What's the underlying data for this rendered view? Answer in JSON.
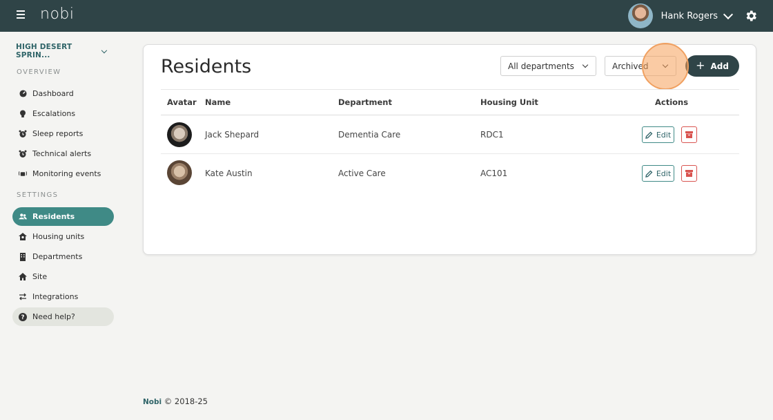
{
  "topbar": {
    "logo": "nobi",
    "user_name": "Hank Rogers"
  },
  "sidebar": {
    "site_name": "HIGH DESERT SPRIN...",
    "overview_label": "OVERVIEW",
    "settings_label": "SETTINGS",
    "overview_items": [
      {
        "label": "Dashboard",
        "icon": "dashboard-icon"
      },
      {
        "label": "Escalations",
        "icon": "lightbulb-icon"
      },
      {
        "label": "Sleep reports",
        "icon": "alarm-icon"
      },
      {
        "label": "Technical alerts",
        "icon": "alarm-icon"
      },
      {
        "label": "Monitoring events",
        "icon": "broadcast-icon"
      }
    ],
    "settings_items": [
      {
        "label": "Residents",
        "icon": "users-icon",
        "active": true
      },
      {
        "label": "Housing units",
        "icon": "house-icon"
      },
      {
        "label": "Departments",
        "icon": "building-icon"
      },
      {
        "label": "Site",
        "icon": "home-icon"
      },
      {
        "label": "Integrations",
        "icon": "swap-icon"
      }
    ],
    "help_label": "Need help?"
  },
  "main": {
    "title": "Residents",
    "department_filter": "All departments",
    "status_filter": "Archived",
    "add_label": "Add",
    "columns": [
      "Avatar",
      "Name",
      "Department",
      "Housing Unit",
      "Actions"
    ],
    "rows": [
      {
        "name": "Jack Shepard",
        "department": "Dementia Care",
        "housing_unit": "RDC1",
        "edit_label": "Edit"
      },
      {
        "name": "Kate Austin",
        "department": "Active Care",
        "housing_unit": "AC101",
        "edit_label": "Edit"
      }
    ]
  },
  "footer": {
    "brand": "Nobi",
    "copyright": "© 2018-25"
  },
  "colors": {
    "topbar": "#2f4447",
    "accent": "#3f8a86",
    "danger": "#d9534f",
    "click_highlight": "#f0a060"
  }
}
